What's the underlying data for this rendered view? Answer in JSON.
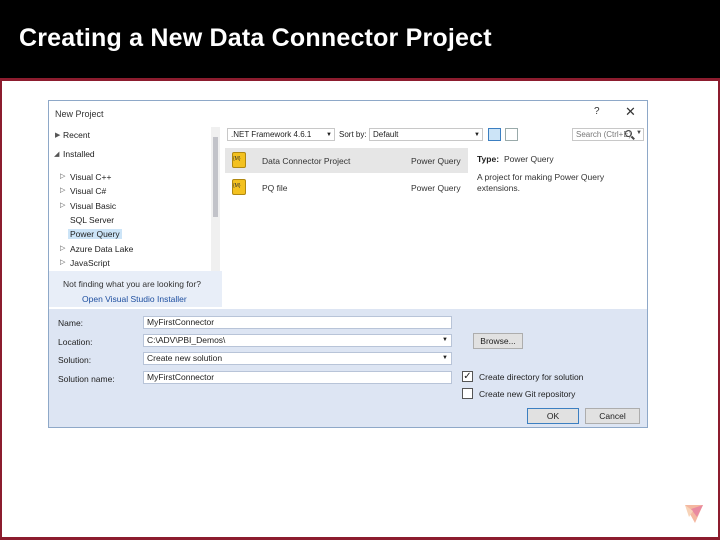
{
  "slide": {
    "title": "Creating a New Data Connector Project",
    "header_color": "#000000",
    "frame_color": "#8c1c2e"
  },
  "dialog": {
    "title": "New Project",
    "help": "?",
    "close": "✕",
    "tree": {
      "recent": "Recent",
      "installed": "Installed",
      "items": [
        "Visual C++",
        "Visual C#",
        "Visual Basic",
        "SQL Server",
        "Power Query",
        "Azure Data Lake",
        "JavaScript"
      ],
      "selected": "Power Query"
    },
    "find": {
      "text": "Not finding what you are looking for?",
      "link": "Open Visual Studio Installer"
    },
    "toolbar": {
      "framework": ".NET Framework 4.6.1",
      "sort_label": "Sort by:",
      "sort_value": "Default",
      "search_placeholder": "Search (Ctrl+E)"
    },
    "templates": [
      {
        "name": "Data Connector Project",
        "lang": "Power Query",
        "icon": "power-query-project-icon"
      },
      {
        "name": "PQ file",
        "lang": "Power Query",
        "icon": "power-query-file-icon"
      }
    ],
    "details": {
      "type_label": "Type:",
      "type_value": "Power Query",
      "description": "A project for making Power Query extensions."
    },
    "form": {
      "name_label": "Name:",
      "name_value": "MyFirstConnector",
      "location_label": "Location:",
      "location_value": "C:\\ADV\\PBI_Demos\\",
      "solution_label": "Solution:",
      "solution_value": "Create new solution",
      "solution_name_label": "Solution name:",
      "solution_name_value": "MyFirstConnector",
      "browse_label": "Browse...",
      "create_dir_label": "Create directory for solution",
      "create_dir_checked": "✓",
      "git_label": "Create new Git repository",
      "ok_label": "OK",
      "cancel_label": "Cancel"
    }
  }
}
